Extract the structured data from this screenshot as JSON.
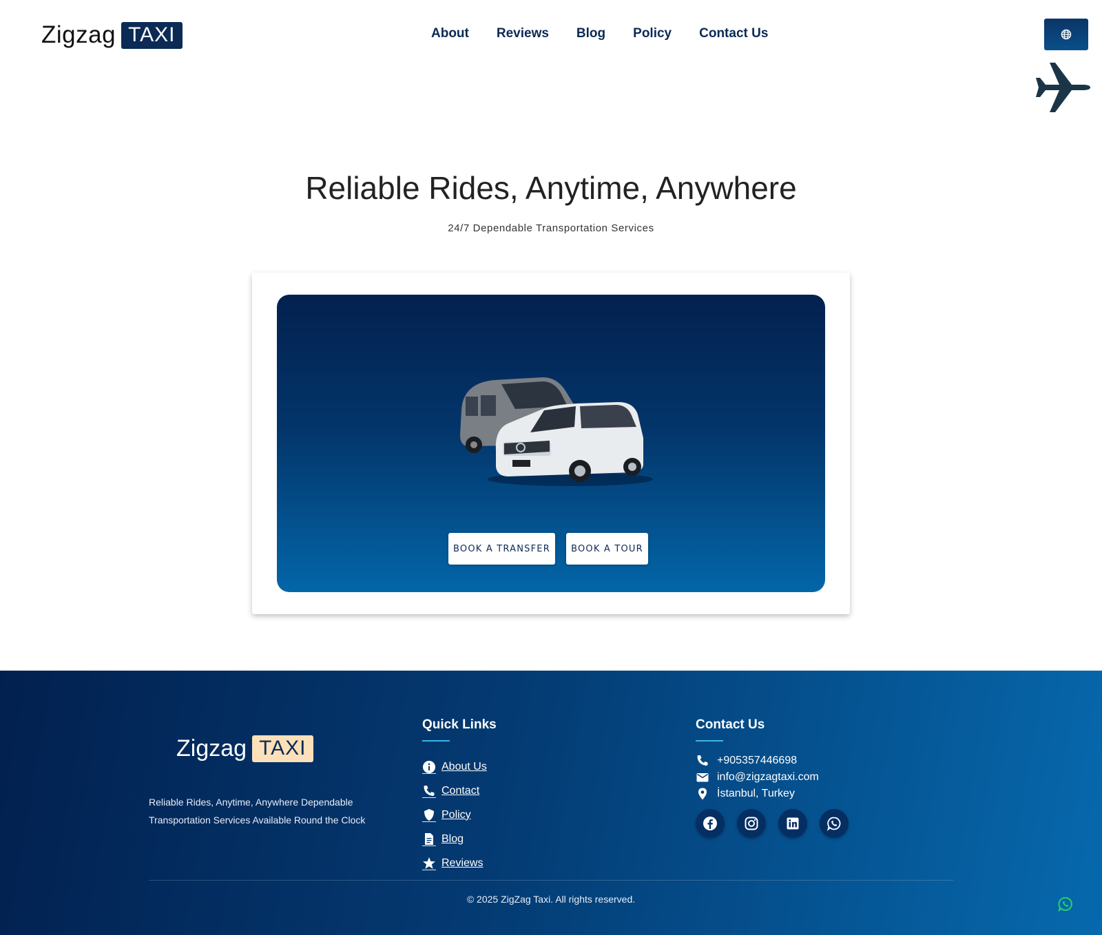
{
  "header": {
    "logo_word": "Zigzag",
    "logo_box": "TAXI",
    "nav": [
      "About",
      "Reviews",
      "Blog",
      "Policy",
      "Contact Us"
    ],
    "language_icon": "globe-icon"
  },
  "hero": {
    "title": "Reliable Rides, Anytime, Anywhere",
    "subtitle": "24/7 Dependable Transportation Services",
    "image_alt": "vans-image",
    "book_transfer": "BOOK A TRANSFER",
    "book_tour": "BOOK A TOUR"
  },
  "footer": {
    "logo_word": "Zigzag",
    "logo_box": "TAXI",
    "tagline": "Reliable Rides, Anytime, Anywhere Dependable Transportation Services Available Round the Clock",
    "quick_links_title": "Quick Links",
    "quick_links": [
      {
        "label": "About Us",
        "icon": "info-icon"
      },
      {
        "label": "Contact",
        "icon": "phone-icon"
      },
      {
        "label": "Policy",
        "icon": "shield-icon"
      },
      {
        "label": "Blog",
        "icon": "document-icon"
      },
      {
        "label": "Reviews",
        "icon": "star-icon"
      }
    ],
    "contact_title": "Contact Us",
    "phone": "+905357446698",
    "email": "info@zigzagtaxi.com",
    "location": "İstanbul, Turkey",
    "socials": [
      "facebook-icon",
      "instagram-icon",
      "linkedin-icon",
      "whatsapp-icon"
    ],
    "copyright": "© 2025 ZigZag Taxi. All rights reserved."
  },
  "colors": {
    "navy": "#0b2a55",
    "accent_line": "#38b6e8",
    "logo_box_footer": "#fbe0b9",
    "whatsapp_green": "#25d366"
  }
}
